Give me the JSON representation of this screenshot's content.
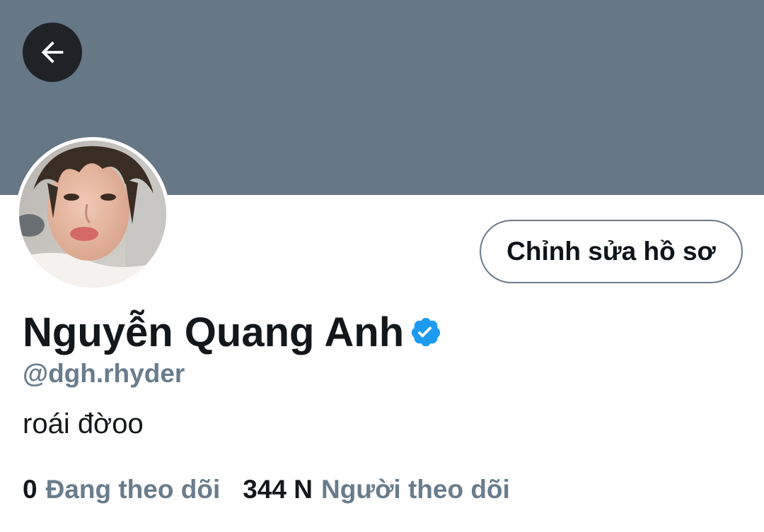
{
  "header": {
    "back_icon": "arrow-left-icon",
    "banner_color": "#667786"
  },
  "profile": {
    "avatar_alt": "avatar",
    "edit_button_label": "Chỉnh sửa hồ sơ",
    "display_name": "Nguyễn Quang Anh",
    "verified_icon": "verified-badge-icon",
    "verified_color": "#1d9bf0",
    "handle": "@dgh.rhyder",
    "bio": "roái đờoo"
  },
  "stats": {
    "following_count": "0",
    "following_label": "Đang theo dõi",
    "followers_count": "344 N",
    "followers_label": "Người theo dõi"
  }
}
